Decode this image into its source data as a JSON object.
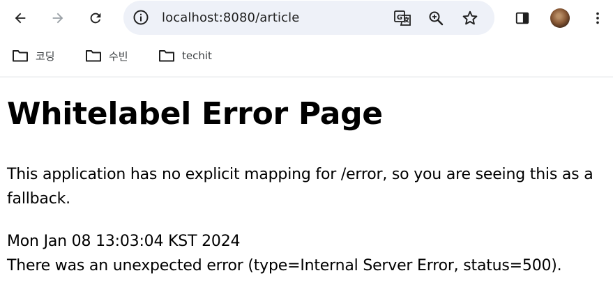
{
  "browser": {
    "url": "localhost:8080/article",
    "bookmarks": [
      {
        "label": "코딩",
        "icon": "folder-icon"
      },
      {
        "label": "수빈",
        "icon": "folder-icon"
      },
      {
        "label": "techit",
        "icon": "folder-icon"
      }
    ]
  },
  "page": {
    "title": "Whitelabel Error Page",
    "message": "This application has no explicit mapping for /error, so you are seeing this as a fallback.",
    "timestamp": "Mon Jan 08 13:03:04 KST 2024",
    "error_detail": "There was an unexpected error (type=Internal Server Error, status=500)."
  },
  "colors": {
    "omnibox_bg": "#eef1f8",
    "icon": "#1f1f1f",
    "forward_disabled": "#9aa0a6"
  }
}
